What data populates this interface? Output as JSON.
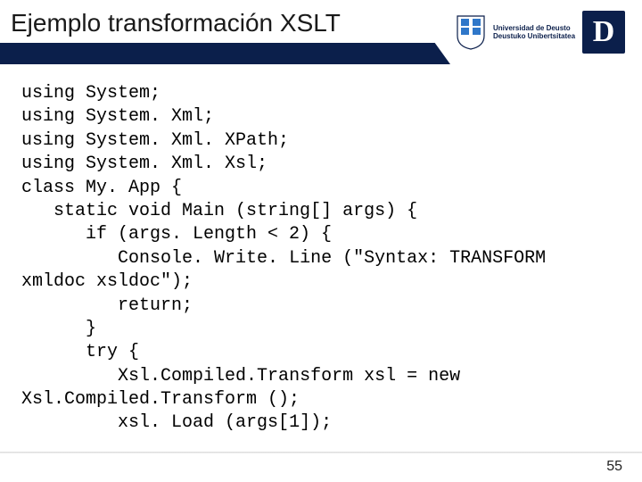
{
  "header": {
    "title": "Ejemplo transformación XSLT",
    "university_line1": "Universidad de Deusto",
    "university_line2": "Deustuko Unibertsitatea",
    "d_letter": "D"
  },
  "code_lines": [
    "using System;",
    "using System. Xml;",
    "using System. Xml. XPath;",
    "using System. Xml. Xsl;",
    "class My. App {",
    "   static void Main (string[] args) {",
    "      if (args. Length < 2) {",
    "         Console. Write. Line (\"Syntax: TRANSFORM xmldoc xsldoc\");",
    "         return;",
    "      }",
    "      try {",
    "         Xsl.Compiled.Transform xsl = new Xsl.Compiled.Transform ();",
    "         xsl. Load (args[1]);"
  ],
  "footer": {
    "page": "55"
  }
}
